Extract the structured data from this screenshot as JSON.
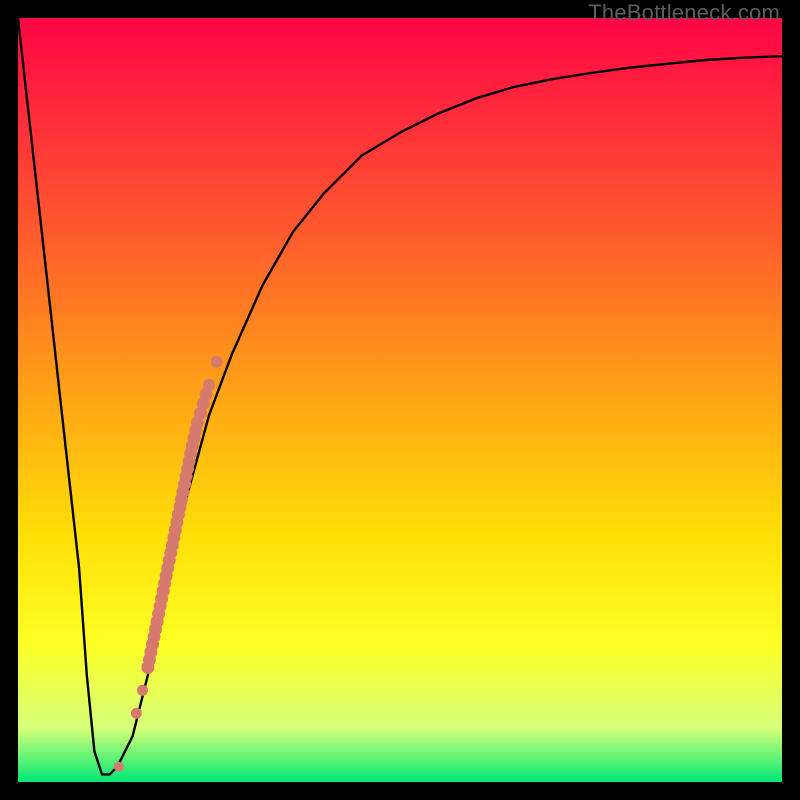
{
  "watermark": "TheBottleneck.com",
  "colors": {
    "frame": "#000000",
    "curve": "#000000",
    "dots": "#d77a6e",
    "gradient_top": "#ff0545",
    "gradient_mid1": "#ff5a2e",
    "gradient_mid2": "#ffa615",
    "gradient_mid3": "#ffe008",
    "gradient_mid4": "#fdff26",
    "gradient_mid5": "#d6ff7a",
    "gradient_bottom": "#00e874"
  },
  "chart_data": {
    "type": "line",
    "title": "",
    "xlabel": "",
    "ylabel": "",
    "xlim": [
      0,
      100
    ],
    "ylim": [
      0,
      100
    ],
    "series": [
      {
        "name": "bottleneck-curve",
        "x": [
          0,
          2,
          4,
          6,
          8,
          9,
          10,
          11,
          12,
          13,
          15,
          18,
          20,
          22,
          25,
          28,
          32,
          36,
          40,
          45,
          50,
          55,
          60,
          65,
          70,
          75,
          80,
          85,
          90,
          95,
          100
        ],
        "y": [
          100,
          82,
          64,
          46,
          28,
          14,
          4,
          1,
          1,
          2,
          6,
          18,
          28,
          37,
          48,
          56,
          65,
          72,
          77,
          82,
          85,
          87.5,
          89.5,
          91,
          92,
          92.8,
          93.5,
          94,
          94.5,
          94.8,
          95
        ]
      }
    ],
    "markers": [
      {
        "name": "highlighted-range",
        "style": "dots",
        "color": "#d77a6e",
        "x": [
          13.2,
          15.5,
          16.3,
          17.0,
          17.8,
          18.6,
          19.4,
          20.2,
          21.0,
          21.8,
          22.6,
          23.5,
          25.0,
          26.0
        ],
        "y": [
          2.0,
          9.0,
          12.0,
          15.0,
          19.0,
          23.0,
          27.0,
          31.0,
          35.0,
          39.0,
          43.0,
          47.0,
          52.0,
          55.0
        ]
      }
    ]
  }
}
